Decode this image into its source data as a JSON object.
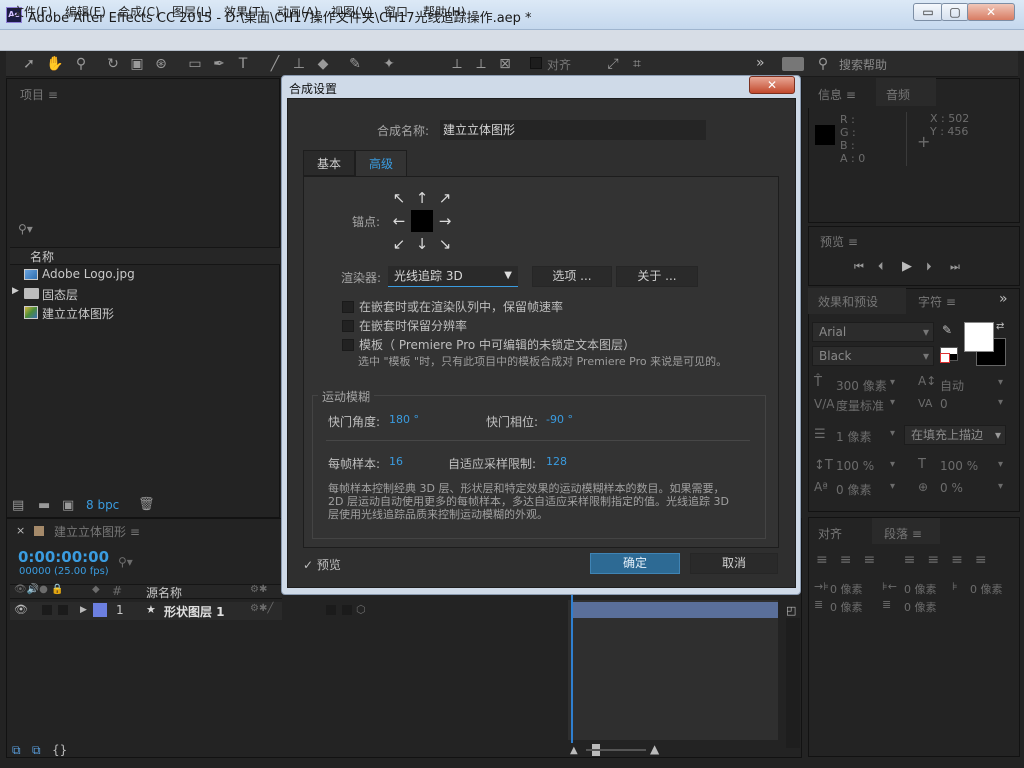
{
  "window": {
    "app_icon": "Ae",
    "title": "Adobe After Effects CC 2015 - D:\\桌面\\CH17操作文件夹\\CH17光线追踪操作.aep *",
    "min": "▭",
    "max": "▢",
    "close": "✕"
  },
  "menu": [
    "文件(F)",
    "编辑(E)",
    "合成(C)",
    "图层(L)",
    "效果(T)",
    "动画(A)",
    "视图(V)",
    "窗口",
    "帮助(H)"
  ],
  "toolbar": {
    "snap_label": "对齐",
    "search_help": "搜索帮助",
    "overflow": "»",
    "icons": [
      "selection-icon",
      "hand-icon",
      "zoom-icon",
      "rotate-icon",
      "camera-icon",
      "pan-behind-icon",
      "rectangle-icon",
      "pen-icon",
      "type-icon",
      "brush-icon",
      "clone-stamp-icon",
      "eraser-icon",
      "roto-brush-icon",
      "puppet-pin-icon",
      "axis-icons",
      "search-icon"
    ]
  },
  "project": {
    "tab": "项目",
    "column_name": "名称",
    "items": [
      {
        "name": "Adobe Logo.jpg",
        "icon": "image-file-icon"
      },
      {
        "name": "固态层",
        "icon": "folder-icon"
      },
      {
        "name": "建立立体图形",
        "icon": "composition-icon"
      }
    ],
    "bpc": "8 bpc"
  },
  "info": {
    "tab_info": "信息",
    "tab_audio": "音频",
    "r": "R :",
    "g": "G :",
    "b": "B :",
    "a": "A : 0",
    "x": "X : 502",
    "y": "Y : 456"
  },
  "preview_tab": "预览",
  "character": {
    "tab_effects": "效果和预设",
    "tab_char": "字符",
    "font": "Arial",
    "style": "Black",
    "size": "300 像素",
    "leading": "自动",
    "kerning": "度量标准",
    "tracking": "0",
    "stroke_width": "1 像素",
    "stroke_mode": "在填充上描边",
    "v_scale": "100 %",
    "h_scale": "100 %",
    "baseline": "0 像素",
    "tsume": "0 %"
  },
  "paragraph": {
    "tab_align": "对齐",
    "tab_para": "段落",
    "indent_left": "0 像素",
    "indent_right": "0 像素",
    "indent_first": "0 像素",
    "space_before": "0 像素",
    "space_after": "0 像素"
  },
  "timeline": {
    "tab": "建立立体图形",
    "timecode": "0:00:00:00",
    "frame": "00000 (25.00 fps)",
    "col_hash": "#",
    "col_source": "源名称",
    "layer_index": "1",
    "layer_name": "形状图层 1"
  },
  "dialog": {
    "title": "合成设置",
    "close": "✕",
    "comp_name_label": "合成名称:",
    "comp_name": "建立立体图形",
    "tab_basic": "基本",
    "tab_advanced": "高级",
    "anchor_label": "锚点:",
    "renderer_label": "渲染器:",
    "renderer_value": "光线追踪 3D",
    "options_button": "选项 ...",
    "about_button": "关于 ...",
    "check1": "在嵌套时或在渲染队列中，保留帧速率",
    "check2": "在嵌套时保留分辨率",
    "check3": "模板（ Premiere Pro 中可编辑的未锁定文本图层）",
    "template_note": "选中 \"模板 \"时，只有此项目中的模板合成对 Premiere Pro 来说是可见的。",
    "motion_blur_legend": "运动模糊",
    "shutter_angle_label": "快门角度:",
    "shutter_angle": "180 °",
    "shutter_phase_label": "快门相位:",
    "shutter_phase": "-90 °",
    "samples_label": "每帧样本:",
    "samples": "16",
    "adaptive_label": "自适应采样限制:",
    "adaptive": "128",
    "motion_desc": "每帧样本控制经典 3D 层、形状层和特定效果的运动模糊样本的数目。如果需要，2D 层运动自动使用更多的每帧样本，多达自适应采样限制指定的值。光线追踪 3D 层使用光线追踪品质来控制运动模糊的外观。",
    "preview_label": "预览",
    "preview_check": "✓",
    "ok": "确定",
    "cancel": "取消"
  }
}
